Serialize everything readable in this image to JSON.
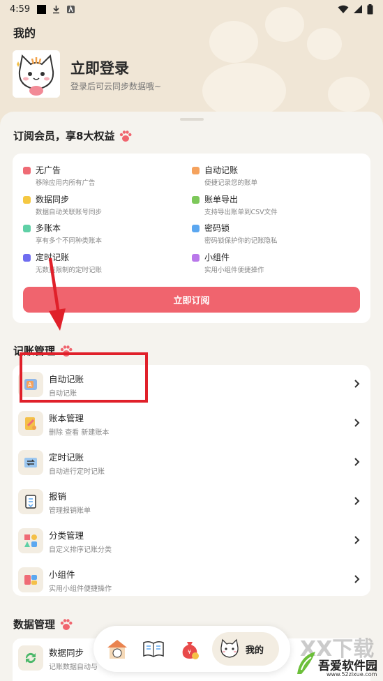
{
  "status_bar": {
    "time": "4:59"
  },
  "header": {
    "title": "我的",
    "login_title": "立即登录",
    "login_subtitle": "登录后可云同步数据哦~"
  },
  "membership": {
    "title": "订阅会员，享8大权益",
    "benefits": [
      {
        "name": "无广告",
        "desc": "移除应用内所有广告",
        "color": "#ef6b75"
      },
      {
        "name": "自动记账",
        "desc": "便捷记录您的账单",
        "color": "#f5a25d"
      },
      {
        "name": "数据同步",
        "desc": "数据自动关联账号同步",
        "color": "#f5c842"
      },
      {
        "name": "账单导出",
        "desc": "支持导出账单到CSV文件",
        "color": "#7dc85a"
      },
      {
        "name": "多账本",
        "desc": "享有多个不同种类账本",
        "color": "#5fd0a6"
      },
      {
        "name": "密码锁",
        "desc": "密码锁保护你的记账隐私",
        "color": "#5ba7f0"
      },
      {
        "name": "定时记账",
        "desc": "无数量限制的定时记账",
        "color": "#6f6df0"
      },
      {
        "name": "小组件",
        "desc": "实用小组件便捷操作",
        "color": "#b978ea"
      }
    ],
    "subscribe_label": "立即订阅"
  },
  "accounting": {
    "title": "记账管理",
    "items": [
      {
        "title": "自动记账",
        "subtitle": "自动记账"
      },
      {
        "title": "账本管理",
        "subtitle": "删除 查看 新建账本"
      },
      {
        "title": "定时记账",
        "subtitle": "自动进行定时记账"
      },
      {
        "title": "报销",
        "subtitle": "管理报销账单"
      },
      {
        "title": "分类管理",
        "subtitle": "自定义排序记账分类"
      },
      {
        "title": "小组件",
        "subtitle": "实用小组件便捷操作"
      }
    ]
  },
  "data_mgmt": {
    "title": "数据管理",
    "items": [
      {
        "title": "数据同步",
        "subtitle": "记账数据自动与"
      }
    ]
  },
  "bottom_nav": {
    "active_label": "我的"
  },
  "watermark": {
    "name": "吾爱软件园",
    "url": "www.52zixue.com",
    "overlay": "XX下载"
  }
}
